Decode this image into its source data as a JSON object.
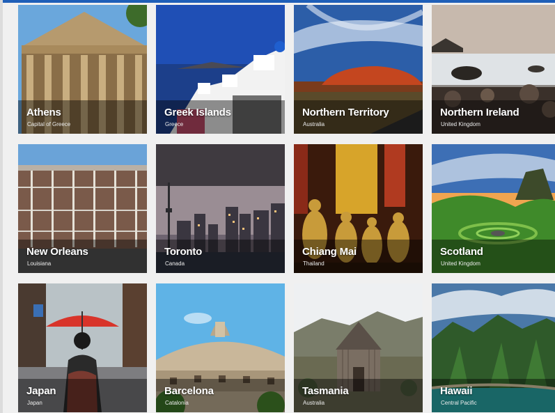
{
  "destinations": [
    {
      "name": "Athens",
      "subtitle": "Capital of Greece"
    },
    {
      "name": "Greek Islands",
      "subtitle": "Greece"
    },
    {
      "name": "Northern Territory",
      "subtitle": "Australia"
    },
    {
      "name": "Northern Ireland",
      "subtitle": "United Kingdom"
    },
    {
      "name": "New Orleans",
      "subtitle": "Louisiana"
    },
    {
      "name": "Toronto",
      "subtitle": "Canada"
    },
    {
      "name": "Chiang Mai",
      "subtitle": "Thailand"
    },
    {
      "name": "Scotland",
      "subtitle": "United Kingdom"
    },
    {
      "name": "Japan",
      "subtitle": "Japan"
    },
    {
      "name": "Barcelona",
      "subtitle": "Catalonia"
    },
    {
      "name": "Tasmania",
      "subtitle": "Australia"
    },
    {
      "name": "Hawaii",
      "subtitle": "Central Pacific"
    }
  ],
  "colors": {
    "accent": "#1f5fb8",
    "page_background": "#f0f0f0"
  }
}
